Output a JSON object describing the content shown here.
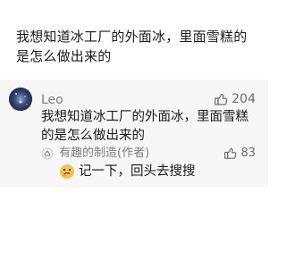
{
  "question": {
    "text": "我想知道冰工厂的外面冰，里面雪糕的是怎么做出来的"
  },
  "comment": {
    "username": "Leo",
    "likes": "204",
    "text": "记一下，回头去搜搜"
  },
  "reply": {
    "author": "有趣的制造(作者)",
    "likes": "83",
    "text": "记一下，回头去搜搜",
    "emoji": "thinking-face"
  },
  "colors": {
    "card_bg": "#f7f7f7",
    "muted_text": "#7e7e7e",
    "primary_text": "#1a1a1a"
  }
}
